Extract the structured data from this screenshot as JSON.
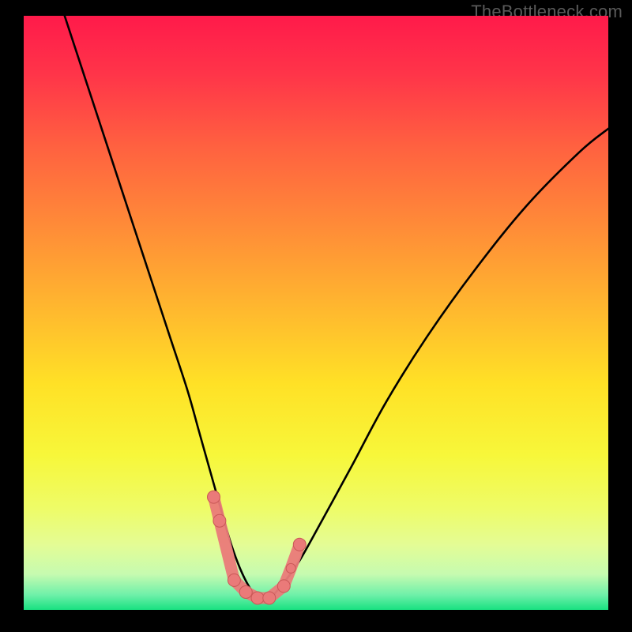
{
  "attribution": "TheBottleneck.com",
  "colors": {
    "black": "#000000",
    "curve": "#000000",
    "marker_fill": "#ea7a79",
    "marker_stroke": "#c95756",
    "gradient_stops": [
      {
        "offset": 0.0,
        "color": "#ff1a4a"
      },
      {
        "offset": 0.1,
        "color": "#ff3549"
      },
      {
        "offset": 0.22,
        "color": "#ff6140"
      },
      {
        "offset": 0.35,
        "color": "#ff8a38"
      },
      {
        "offset": 0.5,
        "color": "#ffba2e"
      },
      {
        "offset": 0.62,
        "color": "#ffe126"
      },
      {
        "offset": 0.74,
        "color": "#f7f73a"
      },
      {
        "offset": 0.83,
        "color": "#eefc68"
      },
      {
        "offset": 0.89,
        "color": "#e4fc95"
      },
      {
        "offset": 0.94,
        "color": "#c6fbb0"
      },
      {
        "offset": 0.975,
        "color": "#6ef0a9"
      },
      {
        "offset": 1.0,
        "color": "#18e180"
      }
    ]
  },
  "chart_data": {
    "type": "line",
    "title": "",
    "xlabel": "",
    "ylabel": "",
    "xlim": [
      0,
      100
    ],
    "ylim": [
      0,
      100
    ],
    "series": [
      {
        "name": "bottleneck-curve",
        "x": [
          7,
          10,
          13,
          16,
          19,
          22,
          25,
          28,
          30,
          32,
          34,
          35.5,
          37,
          38.5,
          40,
          42,
          44,
          47,
          51,
          56,
          62,
          69,
          77,
          86,
          95,
          100
        ],
        "values": [
          100,
          91,
          82,
          73,
          64,
          55,
          46,
          37,
          30,
          23,
          16,
          11,
          7,
          4,
          2,
          2,
          4,
          8,
          15,
          24,
          35,
          46,
          57,
          68,
          77,
          81
        ]
      }
    ],
    "markers": {
      "name": "highlighted-points",
      "x": [
        32.5,
        33.5,
        36,
        38,
        40,
        42,
        44.5,
        45.7,
        47.2
      ],
      "values": [
        19,
        15,
        5,
        3,
        2,
        2,
        4,
        7,
        11
      ],
      "r": [
        8,
        8,
        8,
        8,
        8,
        8,
        8,
        6,
        8
      ]
    }
  }
}
